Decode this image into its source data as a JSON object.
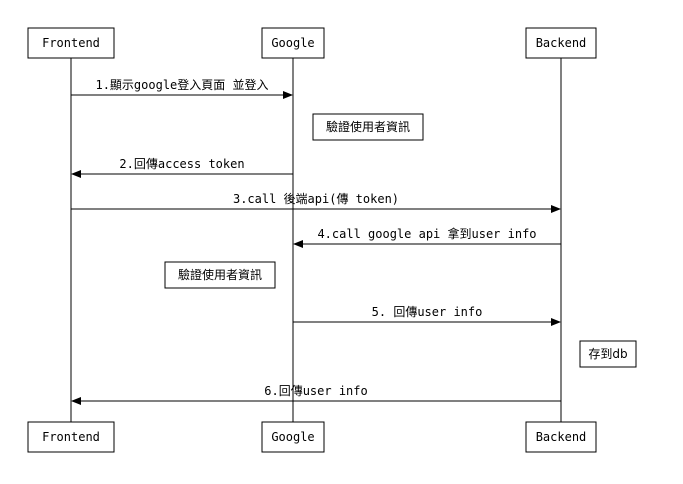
{
  "participants": [
    {
      "id": "frontend",
      "label": "Frontend"
    },
    {
      "id": "google",
      "label": "Google"
    },
    {
      "id": "backend",
      "label": "Backend"
    }
  ],
  "messages": [
    {
      "from": "frontend",
      "to": "google",
      "label": "1.顯示google登入頁面 並登入"
    },
    {
      "from": "google",
      "to": "frontend",
      "label": "2.回傳access token"
    },
    {
      "from": "frontend",
      "to": "backend",
      "label": "3.call 後端api(傳 token)"
    },
    {
      "from": "backend",
      "to": "google",
      "label": "4.call google api 拿到user info"
    },
    {
      "from": "google",
      "to": "backend",
      "label": "5. 回傳user info"
    },
    {
      "from": "backend",
      "to": "frontend",
      "label": "6.回傳user info"
    }
  ],
  "notes": [
    {
      "label": "驗證使用者資訊"
    },
    {
      "label": "驗證使用者資訊"
    },
    {
      "label": "存到db"
    }
  ],
  "colors": {
    "line": "#000000",
    "background": "#ffffff"
  }
}
